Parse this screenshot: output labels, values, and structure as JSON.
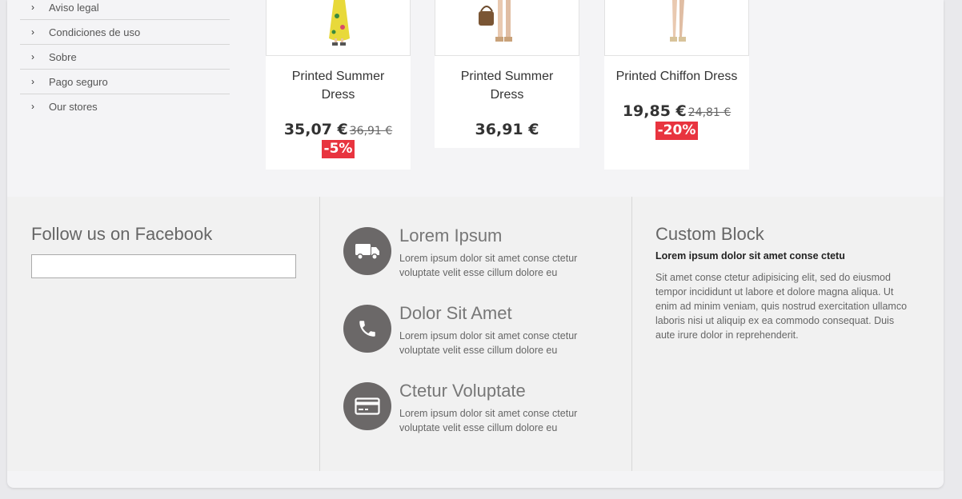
{
  "info_links": [
    {
      "label": "Aviso legal"
    },
    {
      "label": "Condiciones de uso"
    },
    {
      "label": "Sobre"
    },
    {
      "label": "Pago seguro"
    },
    {
      "label": "Our stores"
    }
  ],
  "products": [
    {
      "name": "Printed Summer Dress",
      "price": "35,07 €",
      "old_price": "36,91 €",
      "discount": "-5%"
    },
    {
      "name": "Printed Summer Dress",
      "price": "36,91 €"
    },
    {
      "name": "Printed Chiffon Dress",
      "price": "19,85 €",
      "old_price": "24,81 €",
      "discount": "-20%"
    }
  ],
  "footer": {
    "facebook": {
      "title": "Follow us on Facebook"
    },
    "reassurance": [
      {
        "icon": "truck-icon",
        "title": "Lorem Ipsum",
        "text": "Lorem ipsum dolor sit amet conse ctetur voluptate velit esse cillum dolore eu"
      },
      {
        "icon": "phone-icon",
        "title": "Dolor Sit Amet",
        "text": "Lorem ipsum dolor sit amet conse ctetur voluptate velit esse cillum dolore eu"
      },
      {
        "icon": "credit-card-icon",
        "title": "Ctetur Voluptate",
        "text": "Lorem ipsum dolor sit amet conse ctetur voluptate velit esse cillum dolore eu"
      }
    ],
    "custom_block": {
      "title": "Custom Block",
      "subtitle": "Lorem ipsum dolor sit amet conse ctetu",
      "text": "Sit amet conse ctetur adipisicing elit, sed do eiusmod tempor incididunt ut labore et dolore magna aliqua. Ut enim ad minim veniam, quis nostrud exercitation ullamco laboris nisi ut aliquip ex ea commodo consequat. Duis aute irure dolor in reprehenderit."
    }
  },
  "colors": {
    "discount_badge": "#e8343f",
    "icon_circle": "#6b6868"
  }
}
